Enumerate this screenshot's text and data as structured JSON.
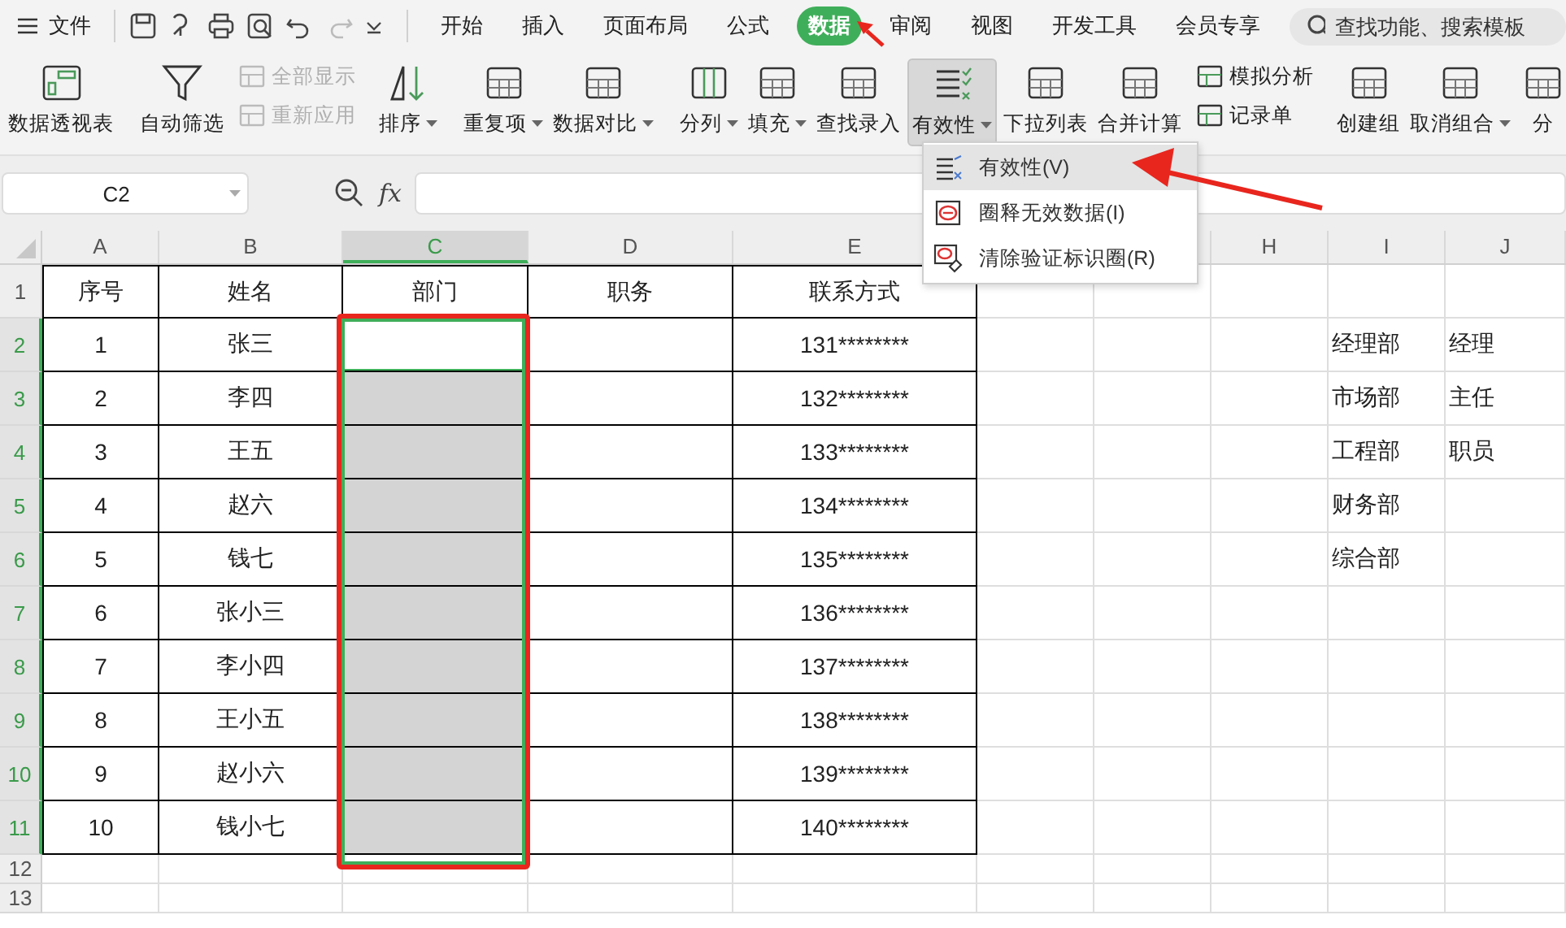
{
  "menu_bar": {
    "file_label": "文件",
    "tabs": [
      {
        "label": "开始",
        "selected": false
      },
      {
        "label": "插入",
        "selected": false
      },
      {
        "label": "页面布局",
        "selected": false
      },
      {
        "label": "公式",
        "selected": false
      },
      {
        "label": "数据",
        "selected": true
      },
      {
        "label": "审阅",
        "selected": false
      },
      {
        "label": "视图",
        "selected": false
      },
      {
        "label": "开发工具",
        "selected": false
      },
      {
        "label": "会员专享",
        "selected": false
      }
    ],
    "search": {
      "placeholder": "查找功能、搜索模板"
    }
  },
  "ribbon": {
    "groups": [
      [
        {
          "kind": "large",
          "label": "数据透视表",
          "dropdown": false,
          "pressed": false
        }
      ],
      [
        {
          "kind": "large",
          "label": "自动筛选",
          "dropdown": false,
          "pressed": false
        },
        {
          "kind": "stack",
          "entries": [
            {
              "label": "全部显示",
              "disabled": true
            },
            {
              "label": "重新应用",
              "disabled": true
            }
          ]
        }
      ],
      [
        {
          "kind": "large",
          "label": "排序",
          "dropdown": true,
          "pressed": false
        }
      ],
      [
        {
          "kind": "large",
          "label": "重复项",
          "dropdown": true,
          "pressed": false
        },
        {
          "kind": "large",
          "label": "数据对比",
          "dropdown": true,
          "pressed": false
        }
      ],
      [
        {
          "kind": "large",
          "label": "分列",
          "dropdown": true,
          "pressed": false
        },
        {
          "kind": "large",
          "label": "填充",
          "dropdown": true,
          "pressed": false
        },
        {
          "kind": "large",
          "label": "查找录入",
          "dropdown": false,
          "pressed": false
        },
        {
          "kind": "large",
          "label": "有效性",
          "dropdown": true,
          "pressed": true
        },
        {
          "kind": "large",
          "label": "下拉列表",
          "dropdown": false,
          "pressed": false
        },
        {
          "kind": "large",
          "label": "合并计算",
          "dropdown": false,
          "pressed": false
        },
        {
          "kind": "stack",
          "entries": [
            {
              "label": "模拟分析",
              "disabled": false
            },
            {
              "label": "记录单",
              "disabled": false
            }
          ]
        }
      ],
      [
        {
          "kind": "large",
          "label": "创建组",
          "dropdown": false,
          "pressed": false
        },
        {
          "kind": "large",
          "label": "取消组合",
          "dropdown": true,
          "pressed": false
        },
        {
          "kind": "large",
          "label": "分",
          "dropdown": false,
          "pressed": false
        }
      ]
    ]
  },
  "formula_bar": {
    "name_box": "C2",
    "function_label": "fx"
  },
  "columns": [
    {
      "label": "A",
      "selected": false
    },
    {
      "label": "B",
      "selected": false
    },
    {
      "label": "C",
      "selected": true
    },
    {
      "label": "D",
      "selected": false
    },
    {
      "label": "E",
      "selected": false
    },
    {},
    {},
    {
      "label": "H",
      "selected": false
    },
    {
      "label": "I",
      "selected": false
    },
    {
      "label": "J",
      "selected": false
    }
  ],
  "rows": [
    {
      "header": "1",
      "selected": false,
      "active": false,
      "no": "序号",
      "name": "姓名",
      "dept": "部门",
      "position": "职务",
      "phone": "联系方式"
    },
    {
      "header": "2",
      "selected": true,
      "active": true,
      "no": "1",
      "name": "张三",
      "phone": "131********",
      "dept_option": "经理部",
      "title_option": "经理"
    },
    {
      "header": "3",
      "selected": true,
      "active": false,
      "no": "2",
      "name": "李四",
      "phone": "132********",
      "dept_option": "市场部",
      "title_option": "主任"
    },
    {
      "header": "4",
      "selected": true,
      "active": false,
      "no": "3",
      "name": "王五",
      "phone": "133********",
      "dept_option": "工程部",
      "title_option": "职员"
    },
    {
      "header": "5",
      "selected": true,
      "active": false,
      "no": "4",
      "name": "赵六",
      "phone": "134********",
      "dept_option": "财务部"
    },
    {
      "header": "6",
      "selected": true,
      "active": false,
      "no": "5",
      "name": "钱七",
      "phone": "135********",
      "dept_option": "综合部"
    },
    {
      "header": "7",
      "selected": true,
      "active": false,
      "no": "6",
      "name": "张小三",
      "phone": "136********"
    },
    {
      "header": "8",
      "selected": true,
      "active": false,
      "no": "7",
      "name": "李小四",
      "phone": "137********"
    },
    {
      "header": "9",
      "selected": true,
      "active": false,
      "no": "8",
      "name": "王小五",
      "phone": "138********"
    },
    {
      "header": "10",
      "selected": true,
      "active": false,
      "no": "9",
      "name": "赵小六",
      "phone": "139********"
    },
    {
      "header": "11",
      "selected": true,
      "active": false,
      "no": "10",
      "name": "钱小七",
      "phone": "140********"
    },
    {
      "header": "12",
      "selected": false,
      "active": false
    },
    {
      "header": "13",
      "selected": false,
      "active": false
    }
  ],
  "dropdown_menu": {
    "items": [
      {
        "label": "有效性(V)",
        "selected": true
      },
      {
        "label": "圈释无效数据(I)",
        "selected": false
      },
      {
        "label": "清除验证标识圈(R)",
        "selected": false
      }
    ]
  },
  "annotations": [
    {
      "kind": "arrow"
    },
    {
      "kind": "arrow"
    },
    {
      "kind": "box"
    }
  ]
}
